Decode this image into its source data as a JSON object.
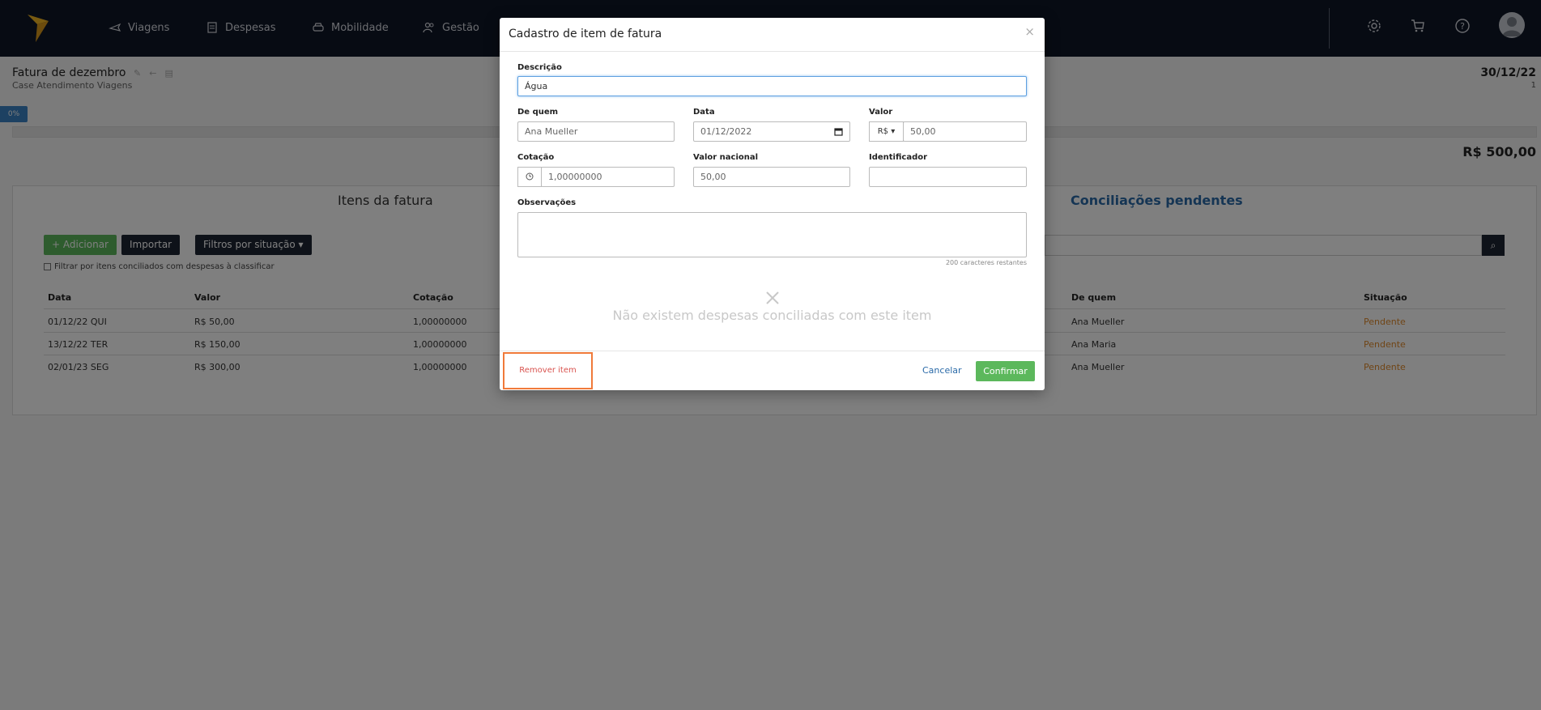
{
  "nav": {
    "items": [
      {
        "label": "Viagens",
        "icon": "plane-icon"
      },
      {
        "label": "Despesas",
        "icon": "receipt-icon"
      },
      {
        "label": "Mobilidade",
        "icon": "car-icon"
      },
      {
        "label": "Gestão",
        "icon": "users-icon"
      }
    ],
    "right_icons": [
      "gear-icon",
      "cart-icon",
      "help-icon",
      "user-avatar-icon"
    ]
  },
  "page": {
    "title": "Fatura de dezembro",
    "subtitle": "Case Atendimento Viagens",
    "date": "30/12/22",
    "number": "1",
    "progress_label": "0%",
    "progress": 0,
    "total": "R$ 500,00",
    "tabs": {
      "left": "Itens da fatura",
      "right": "Conciliações pendentes"
    },
    "buttons": {
      "add": "+ Adicionar",
      "import": "Importar",
      "filter": "Filtros por situação ▾"
    },
    "checkbox_label": "Filtrar por itens conciliados com despesas à classificar",
    "table": {
      "headers": {
        "data": "Data",
        "valor": "Valor",
        "cotacao": "Cotação",
        "de_quem": "De quem",
        "situacao": "Situação"
      },
      "rows": [
        {
          "data": "01/12/22 QUI",
          "valor": "R$ 50,00",
          "cotacao": "1,00000000",
          "de_quem": "Ana Mueller",
          "situacao": "Pendente"
        },
        {
          "data": "13/12/22 TER",
          "valor": "R$ 150,00",
          "cotacao": "1,00000000",
          "de_quem": "Ana Maria",
          "situacao": "Pendente"
        },
        {
          "data": "02/01/23 SEG",
          "valor": "R$ 300,00",
          "cotacao": "1,00000000",
          "de_quem": "Ana Mueller",
          "situacao": "Pendente"
        }
      ]
    }
  },
  "modal": {
    "title": "Cadastro de item de fatura",
    "close": "×",
    "descricao_label": "Descrição",
    "descricao_value": "Água",
    "de_quem_label": "De quem",
    "de_quem_value": "Ana Mueller",
    "data_label": "Data",
    "data_value": "01/12/2022",
    "valor_label": "Valor",
    "valor_currency": "R$ ▾",
    "valor_value": "50,00",
    "cotacao_label": "Cotação",
    "cotacao_value": "1,00000000",
    "valor_nacional_label": "Valor nacional",
    "valor_nacional_value": "50,00",
    "identificador_label": "Identificador",
    "identificador_value": "",
    "observacoes_label": "Observações",
    "char_count": "200 caracteres restantes",
    "empty_message": "Não existem despesas conciliadas com este item",
    "remove_label": "Remover item",
    "cancel_label": "Cancelar",
    "confirm_label": "Confirmar"
  },
  "colors": {
    "nav_bg": "#0f1626",
    "accent_green": "#5cb85c",
    "link_blue": "#2a6aa8",
    "pending_orange": "#e08a2c",
    "highlight_orange": "#f07a3a"
  }
}
